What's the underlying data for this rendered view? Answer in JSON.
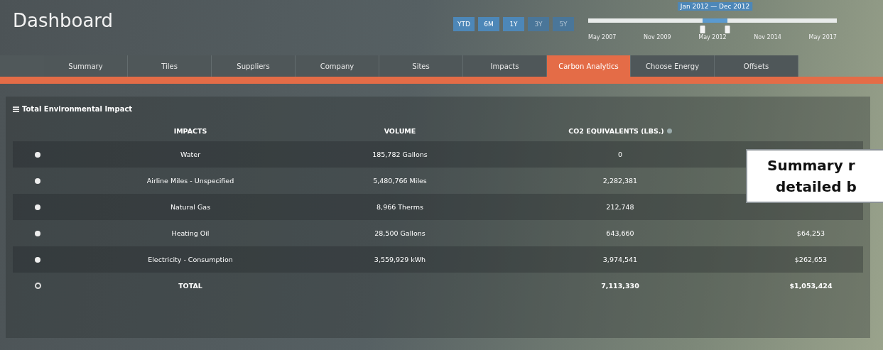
{
  "window": {
    "title": "Dashboard"
  },
  "range_buttons": [
    {
      "label": "YTD",
      "disabled": false
    },
    {
      "label": "6M",
      "disabled": false
    },
    {
      "label": "1Y",
      "disabled": false
    },
    {
      "label": "3Y",
      "disabled": true
    },
    {
      "label": "5Y",
      "disabled": true
    }
  ],
  "timeline": {
    "range_label": "Jan 2012 — Dec 2012",
    "start": {
      "level": 0.46
    },
    "end": {
      "level": 0.56
    },
    "tick_labels": [
      "May 2007",
      "Nov 2009",
      "May 2012",
      "Nov 2014",
      "May 2017"
    ]
  },
  "tabs": [
    {
      "label": "Summary",
      "selected": false
    },
    {
      "label": "Tiles",
      "selected": false
    },
    {
      "label": "Suppliers",
      "selected": false
    },
    {
      "label": "Company",
      "selected": false
    },
    {
      "label": "Sites",
      "selected": false
    },
    {
      "label": "Impacts",
      "selected": false
    },
    {
      "label": "Carbon Analytics",
      "selected": true
    },
    {
      "label": "Choose Energy",
      "selected": false
    },
    {
      "label": "Offsets",
      "selected": false
    }
  ],
  "panel": {
    "title": "Total Environmental Impact",
    "table": {
      "columns": [
        "IMPACTS",
        "VOLUME",
        "CO2 EQUIVALENTS (LBS.)"
      ],
      "rows": [
        {
          "kind": "item",
          "impact": "Water",
          "volume": "185,782 Gallons",
          "co2": "0"
        },
        {
          "kind": "item",
          "impact": "Airline Miles - Unspecified",
          "volume": "5,480,766 Miles",
          "co2": "2,282,381"
        },
        {
          "kind": "item",
          "impact": "Natural Gas",
          "volume": "8,966 Therms",
          "co2": "212,748"
        },
        {
          "kind": "item",
          "impact": "Heating Oil",
          "volume": "28,500 Gallons",
          "co2": "643,660",
          "column_4": "$64,253"
        },
        {
          "kind": "item",
          "impact": "Electricity - Consumption",
          "volume": "3,559,929 kWh",
          "co2": "3,974,541",
          "column_4": "$262,653"
        },
        {
          "kind": "total",
          "impact": "TOTAL",
          "co2": "7,113,330",
          "column_4": "$1,053,424"
        }
      ]
    }
  },
  "callout": {
    "lines": [
      "Summary r",
      "detailed b"
    ]
  }
}
